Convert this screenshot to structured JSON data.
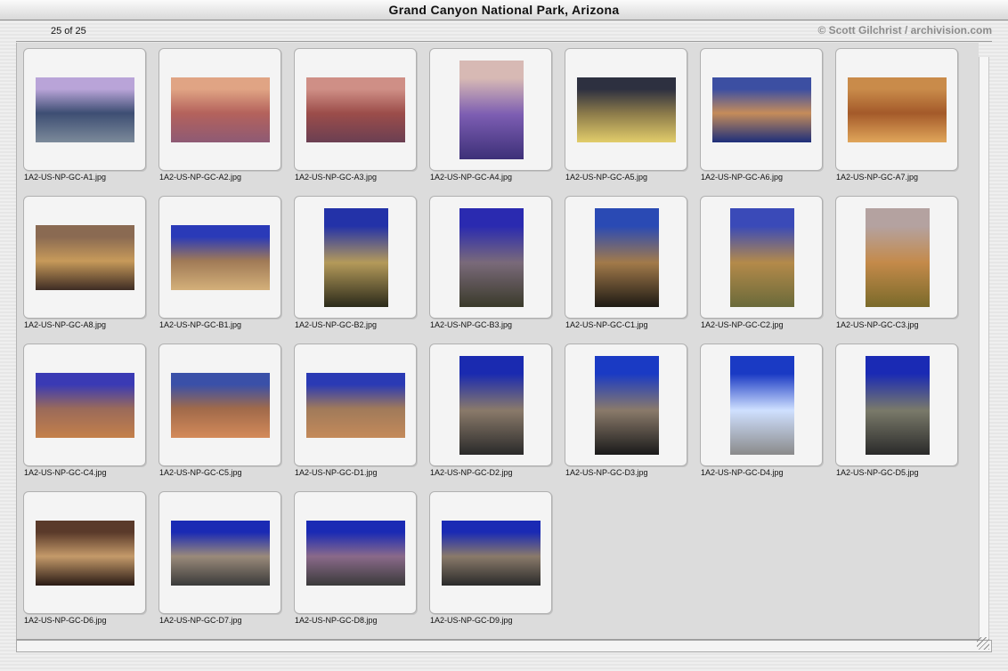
{
  "window": {
    "title": "Grand Canyon National Park, Arizona"
  },
  "header": {
    "count": "25 of 25",
    "credit": "© Scott Gilchrist / archivision.com"
  },
  "thumbnails": [
    {
      "filename": "1A2-US-NP-GC-A1.jpg",
      "orientation": "landscape",
      "colors": [
        "#b9a4d8",
        "#3d4e73",
        "#7c8a9a"
      ]
    },
    {
      "filename": "1A2-US-NP-GC-A2.jpg",
      "orientation": "landscape",
      "colors": [
        "#e0a484",
        "#b4625c",
        "#8e5a74"
      ]
    },
    {
      "filename": "1A2-US-NP-GC-A3.jpg",
      "orientation": "landscape",
      "colors": [
        "#cf8f86",
        "#9c4d4a",
        "#6b3f52"
      ]
    },
    {
      "filename": "1A2-US-NP-GC-A4.jpg",
      "orientation": "portrait",
      "colors": [
        "#d7b9b4",
        "#7c5db2",
        "#3d3078"
      ]
    },
    {
      "filename": "1A2-US-NP-GC-A5.jpg",
      "orientation": "landscape",
      "colors": [
        "#2d3040",
        "#8b7a4a",
        "#e2cd6a"
      ]
    },
    {
      "filename": "1A2-US-NP-GC-A6.jpg",
      "orientation": "landscape",
      "colors": [
        "#3c4fa2",
        "#c58c5a",
        "#1d2e7a"
      ]
    },
    {
      "filename": "1A2-US-NP-GC-A7.jpg",
      "orientation": "landscape",
      "colors": [
        "#c98b4a",
        "#a45a2a",
        "#e0a65a"
      ]
    },
    {
      "filename": "1A2-US-NP-GC-A8.jpg",
      "orientation": "landscape",
      "colors": [
        "#8a6a52",
        "#c79a5a",
        "#3e2c24"
      ]
    },
    {
      "filename": "1A2-US-NP-GC-B1.jpg",
      "orientation": "landscape",
      "colors": [
        "#2a3ab8",
        "#a07a56",
        "#d4b07a"
      ]
    },
    {
      "filename": "1A2-US-NP-GC-B2.jpg",
      "orientation": "portrait",
      "colors": [
        "#2332a8",
        "#b49a5a",
        "#2b2a1a"
      ]
    },
    {
      "filename": "1A2-US-NP-GC-B3.jpg",
      "orientation": "portrait",
      "colors": [
        "#2a2ab0",
        "#7a6a7a",
        "#3a3a2a"
      ]
    },
    {
      "filename": "1A2-US-NP-GC-C1.jpg",
      "orientation": "portrait",
      "colors": [
        "#2a4ab4",
        "#a27a4a",
        "#1e1a14"
      ]
    },
    {
      "filename": "1A2-US-NP-GC-C2.jpg",
      "orientation": "portrait",
      "colors": [
        "#3a4ab8",
        "#b48a4a",
        "#6a6a3a"
      ]
    },
    {
      "filename": "1A2-US-NP-GC-C3.jpg",
      "orientation": "portrait",
      "colors": [
        "#b4a2a0",
        "#c48a4a",
        "#7a6a2a"
      ]
    },
    {
      "filename": "1A2-US-NP-GC-C4.jpg",
      "orientation": "landscape",
      "colors": [
        "#3a3ab4",
        "#9a6a5a",
        "#c4804a"
      ]
    },
    {
      "filename": "1A2-US-NP-GC-C5.jpg",
      "orientation": "landscape",
      "colors": [
        "#3a50a8",
        "#a06a4a",
        "#d48a5a"
      ]
    },
    {
      "filename": "1A2-US-NP-GC-D1.jpg",
      "orientation": "landscape",
      "colors": [
        "#2a3ab4",
        "#a07a5a",
        "#c48a5a"
      ]
    },
    {
      "filename": "1A2-US-NP-GC-D2.jpg",
      "orientation": "portrait",
      "colors": [
        "#1a2ab0",
        "#8a7a6a",
        "#2a2a2a"
      ]
    },
    {
      "filename": "1A2-US-NP-GC-D3.jpg",
      "orientation": "portrait",
      "colors": [
        "#1a3ac4",
        "#8a7a6a",
        "#1a1a1a"
      ]
    },
    {
      "filename": "1A2-US-NP-GC-D4.jpg",
      "orientation": "portrait",
      "colors": [
        "#1a3ac4",
        "#cfe0ff",
        "#8a8a8a"
      ]
    },
    {
      "filename": "1A2-US-NP-GC-D5.jpg",
      "orientation": "portrait",
      "colors": [
        "#1a2ab4",
        "#7a7a6a",
        "#2a2a2a"
      ]
    },
    {
      "filename": "1A2-US-NP-GC-D6.jpg",
      "orientation": "landscape",
      "colors": [
        "#5a3a2a",
        "#c49a6a",
        "#2a1a14"
      ]
    },
    {
      "filename": "1A2-US-NP-GC-D7.jpg",
      "orientation": "landscape",
      "colors": [
        "#1a2ab4",
        "#9a8a7a",
        "#3a3a3a"
      ]
    },
    {
      "filename": "1A2-US-NP-GC-D8.jpg",
      "orientation": "landscape",
      "colors": [
        "#1a2ab4",
        "#8a6a8a",
        "#3a3a3a"
      ]
    },
    {
      "filename": "1A2-US-NP-GC-D9.jpg",
      "orientation": "landscape",
      "colors": [
        "#1a2ab4",
        "#8a7a6a",
        "#2a2a2a"
      ]
    }
  ]
}
